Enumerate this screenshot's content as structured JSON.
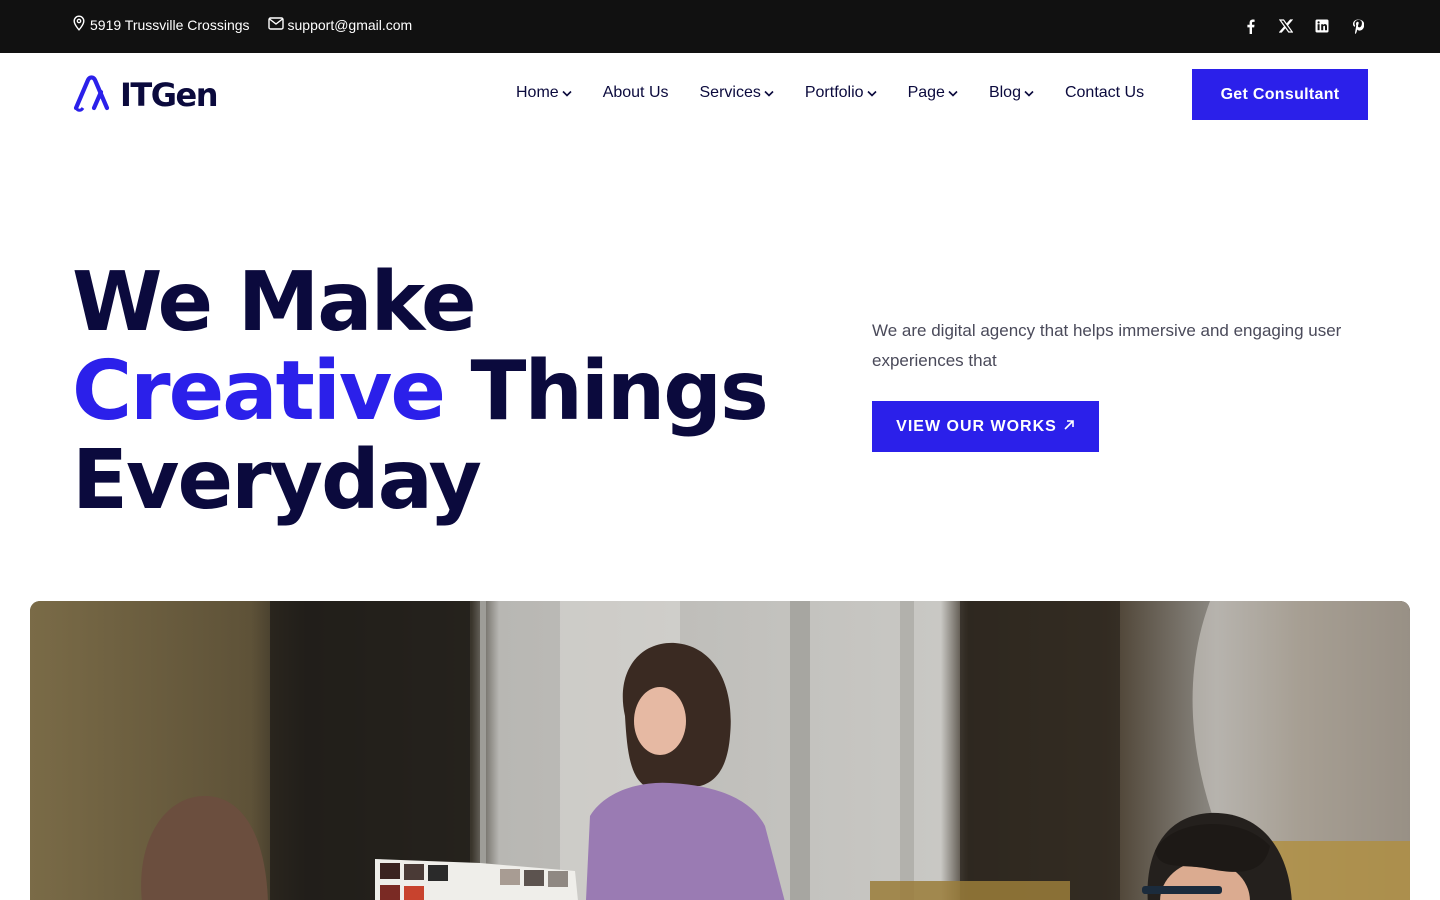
{
  "topbar": {
    "address": "5919 Trussville Crossings",
    "email": "support@gmail.com",
    "social": [
      {
        "icon": "facebook-icon"
      },
      {
        "icon": "x-twitter-icon"
      },
      {
        "icon": "linkedin-icon"
      },
      {
        "icon": "pinterest-icon"
      }
    ]
  },
  "header": {
    "logo_text": "ITGen",
    "nav": [
      {
        "label": "Home",
        "has_dropdown": true
      },
      {
        "label": "About Us",
        "has_dropdown": false
      },
      {
        "label": "Services",
        "has_dropdown": true
      },
      {
        "label": "Portfolio",
        "has_dropdown": true
      },
      {
        "label": "Page",
        "has_dropdown": true
      },
      {
        "label": "Blog",
        "has_dropdown": true
      },
      {
        "label": "Contact Us",
        "has_dropdown": false
      }
    ],
    "cta_label": "Get Consultant"
  },
  "hero": {
    "title_line1": "We Make",
    "title_accent": "Creative",
    "title_line2_rest": "Things",
    "title_line3": "Everyday",
    "description": "We are digital agency that helps immersive and engaging user experiences that",
    "button_label": "VIEW OUR WORKS",
    "image": "team-meeting-photo"
  },
  "colors": {
    "accent": "#2b20ea",
    "dark": "#0b0a3d",
    "topbar_bg": "#111111"
  }
}
